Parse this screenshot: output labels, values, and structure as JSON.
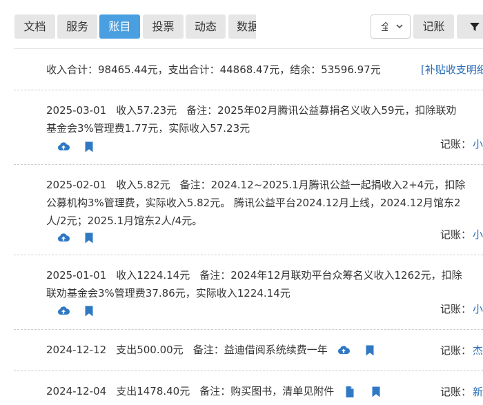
{
  "tabs": [
    {
      "label": "文档",
      "active": false
    },
    {
      "label": "服务",
      "active": false
    },
    {
      "label": "账目",
      "active": true
    },
    {
      "label": "投票",
      "active": false
    },
    {
      "label": "动态",
      "active": false
    },
    {
      "label": "数据",
      "active": false
    }
  ],
  "toolbar": {
    "select_value": "全部",
    "record_label": "记账",
    "filter_icon": "filter-icon"
  },
  "summary": {
    "text": "收入合计：98465.44元，支出合计：44868.47元，结余：53596.97元",
    "link": "[补贴收支明细]"
  },
  "entries": [
    {
      "date": "2025-03-01",
      "amount": "收入57.23元",
      "note_lines": [
        "备注：2025年02月腾讯公益募捐名义收入59元，扣除联劝",
        "基金会3%管理费1.77元，实际收入57.23元"
      ],
      "icons": [
        "cloud-upload-icon",
        "bookmark-icon"
      ],
      "recorder_label": "记账：",
      "recorder": "小"
    },
    {
      "date": "2025-02-01",
      "amount": "收入5.82元",
      "note_lines": [
        "备注：2024.12~2025.1月腾讯公益一起捐收入2+4元，扣除",
        "公募机构3%管理费，实际收入5.82元。 腾讯公益平台2024.12月上线，2024.12月馆东2",
        "人/2元；2025.1月馆东2人/4元。"
      ],
      "icons": [
        "cloud-upload-icon",
        "bookmark-icon"
      ],
      "recorder_label": "记账：",
      "recorder": "小"
    },
    {
      "date": "2025-01-01",
      "amount": "收入1224.14元",
      "note_lines": [
        "备注：2024年12月联劝平台众筹名义收入1262元，扣除",
        "联劝基金会3%管理费37.86元，实际收入1224.14元"
      ],
      "icons": [
        "cloud-upload-icon",
        "bookmark-icon"
      ],
      "recorder_label": "记账：",
      "recorder": "小"
    },
    {
      "date": "2024-12-12",
      "amount": "支出500.00元",
      "note_lines": [
        "备注：益迪借阅系统续费一年"
      ],
      "icons": [
        "cloud-upload-icon",
        "bookmark-icon"
      ],
      "recorder_label": "记账：",
      "recorder": "杰"
    },
    {
      "date": "2024-12-04",
      "amount": "支出1478.40元",
      "note_lines": [
        "备注：购买图书，清单见附件"
      ],
      "icons": [
        "file-icon",
        "bookmark-icon"
      ],
      "recorder_label": "记账：",
      "recorder": "新"
    }
  ],
  "colors": {
    "active_tab": "#4a9fe0",
    "tab_bg": "#e6e6e6",
    "icon_blue": "#2f78c4",
    "link_blue": "#2a6ebb"
  }
}
